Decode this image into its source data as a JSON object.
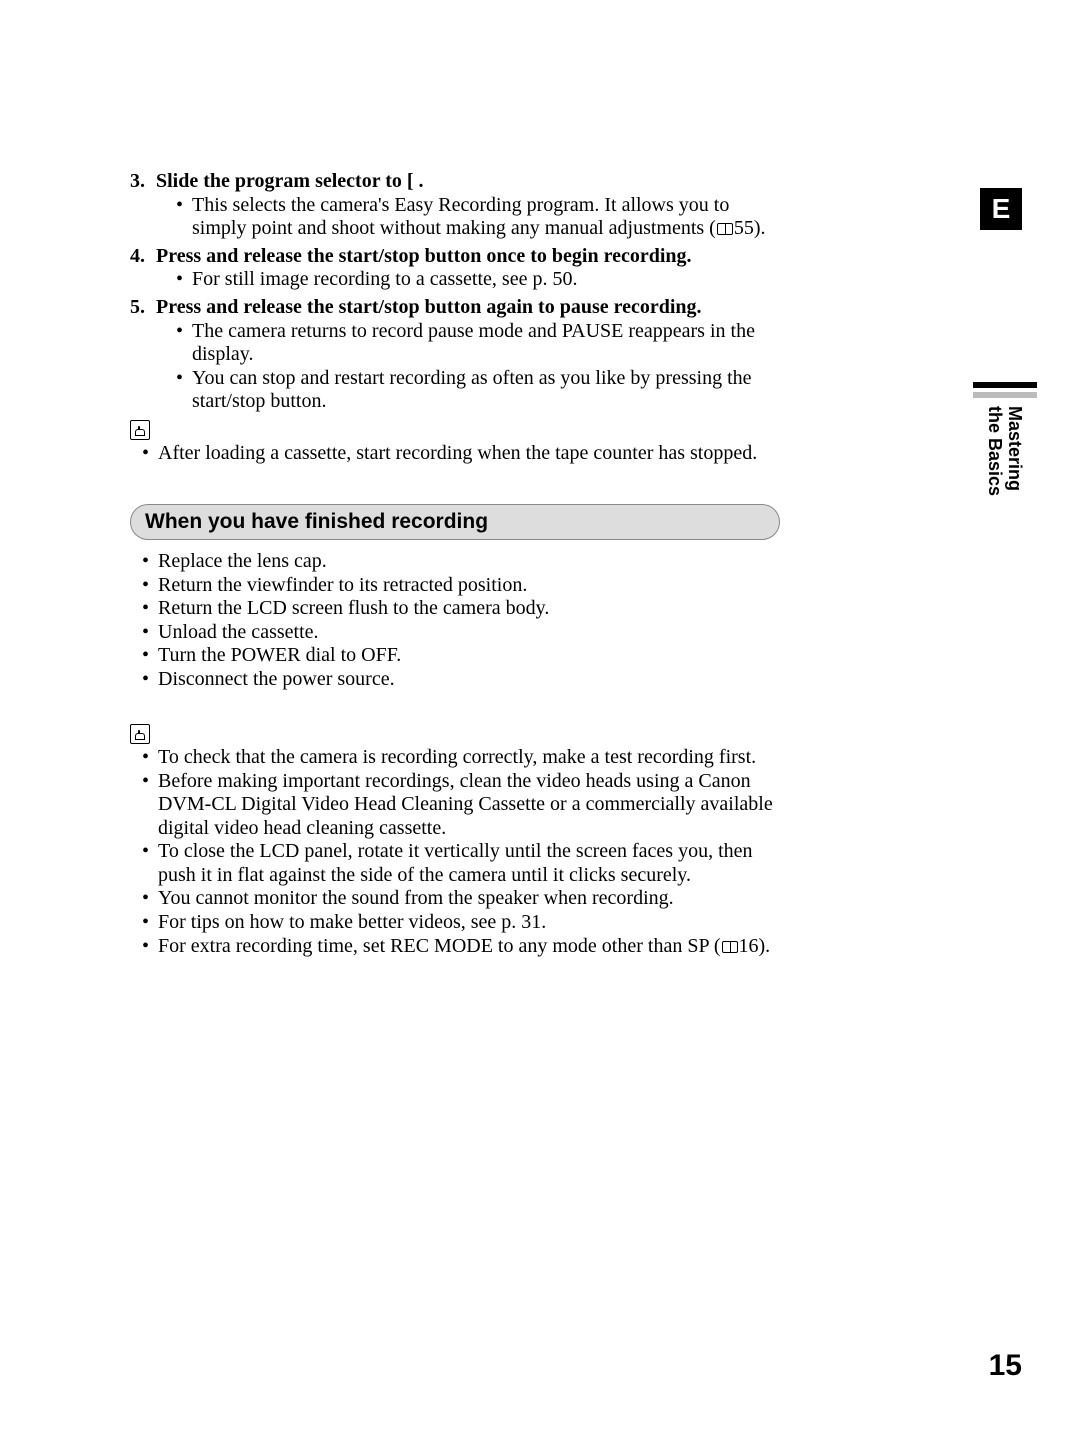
{
  "sideTab": "E",
  "sideLabelLine1": "Mastering",
  "sideLabelLine2": "the Basics",
  "steps": [
    {
      "title": "Slide the program selector to [   .",
      "sub": [
        {
          "text_a": "This selects the camera's Easy Recording program. It allows you to simply point and shoot without making any manual adjustments (",
          "ref": "55",
          "text_b": ")."
        }
      ]
    },
    {
      "title": "Press and release the start/stop button once to begin recording.",
      "sub": [
        {
          "text_a": "For still image recording to a cassette, see p. 50."
        }
      ]
    },
    {
      "title": "Press and release the start/stop button again to pause recording.",
      "sub": [
        {
          "text_a": "The camera returns to record pause mode and PAUSE reappears in the display."
        },
        {
          "text_a": "You can stop and restart recording as often as you like by pressing the start/stop button."
        }
      ]
    }
  ],
  "note1": "After loading a cassette, start recording when the tape counter has stopped.",
  "sectionTitle": "When you have finished recording",
  "finishList": [
    "Replace the lens cap.",
    "Return the viewfinder to its retracted position.",
    "Return the LCD screen flush to the camera body.",
    "Unload the cassette.",
    "Turn the POWER dial to OFF.",
    "Disconnect the power source."
  ],
  "tips": [
    {
      "text_a": "To check that the camera is recording correctly, make a test recording first."
    },
    {
      "text_a": "Before making important recordings, clean the video heads using a Canon DVM-CL Digital Video Head Cleaning Cassette or a commercially available digital video head cleaning cassette."
    },
    {
      "text_a": "To close the LCD panel, rotate it vertically until the screen faces you, then push it in flat against the side of the camera until it clicks securely."
    },
    {
      "text_a": "You cannot monitor the sound from the speaker when recording."
    },
    {
      "text_a": "For tips on how to make better videos, see p. 31."
    },
    {
      "text_a": "For extra recording time, set REC MODE to any mode other than SP (",
      "ref": "16",
      "text_b": ")."
    }
  ],
  "pageNumber": "15"
}
